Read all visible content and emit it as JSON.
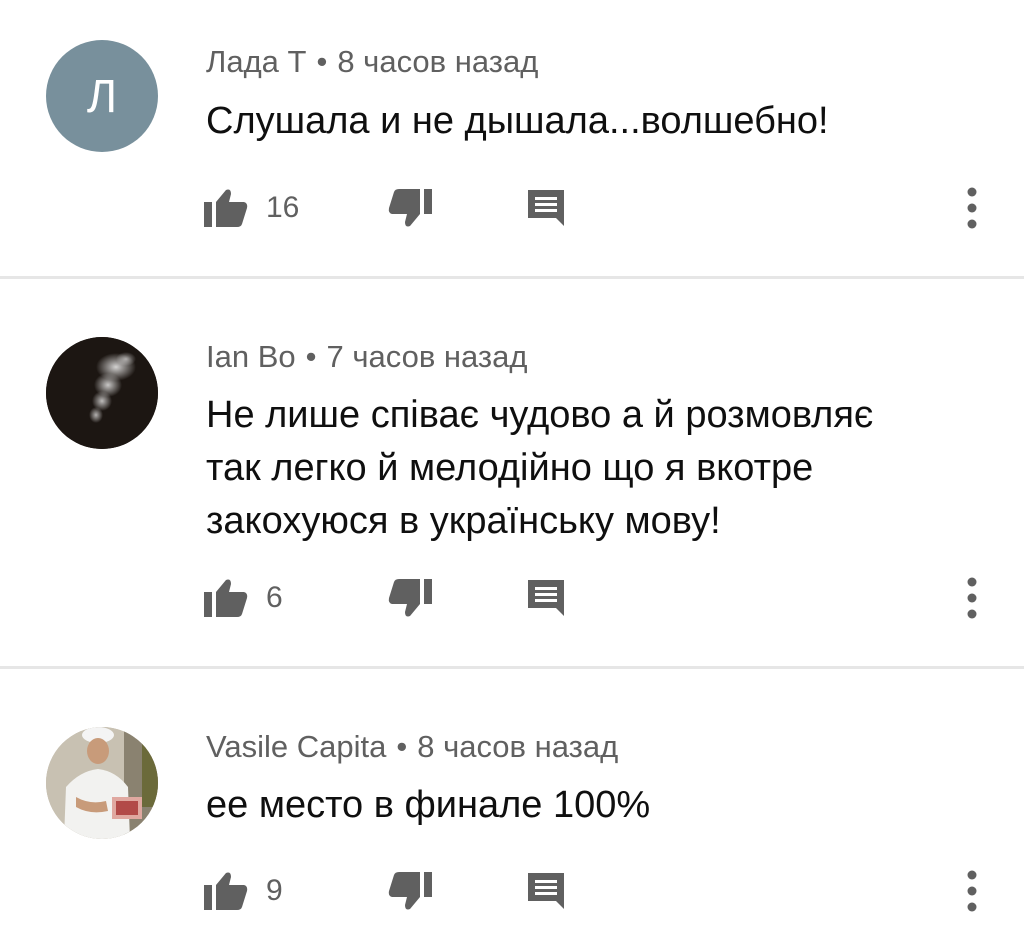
{
  "comments": [
    {
      "author": "Лада Т",
      "separator": "•",
      "time": "8 часов назад",
      "avatar_letter": "Л",
      "text_lines": [
        "Слушала и не дышала...волшебно!"
      ],
      "likes": "16"
    },
    {
      "author": "Ian Bo",
      "separator": "•",
      "time": "7 часов назад",
      "text_lines": [
        "Не лише співає чудово а й розмовляє",
        "так легко й мелодійно що я вкотре",
        "закохуюся в українську мову!"
      ],
      "likes": "6"
    },
    {
      "author": "Vasile Capita",
      "separator": "•",
      "time": "8 часов назад",
      "text_lines": [
        "ее место в финале 100%"
      ],
      "likes": "9"
    }
  ],
  "icons": {
    "like": "thumbs-up-icon",
    "dislike": "thumbs-down-icon",
    "reply": "reply-comment-icon",
    "more": "more-vert-icon"
  },
  "colors": {
    "avatar_letter_bg": "#78909c",
    "icon_gray": "#606060",
    "text": "#0f0f0f",
    "meta": "#606060",
    "divider": "#e6e6e6"
  }
}
